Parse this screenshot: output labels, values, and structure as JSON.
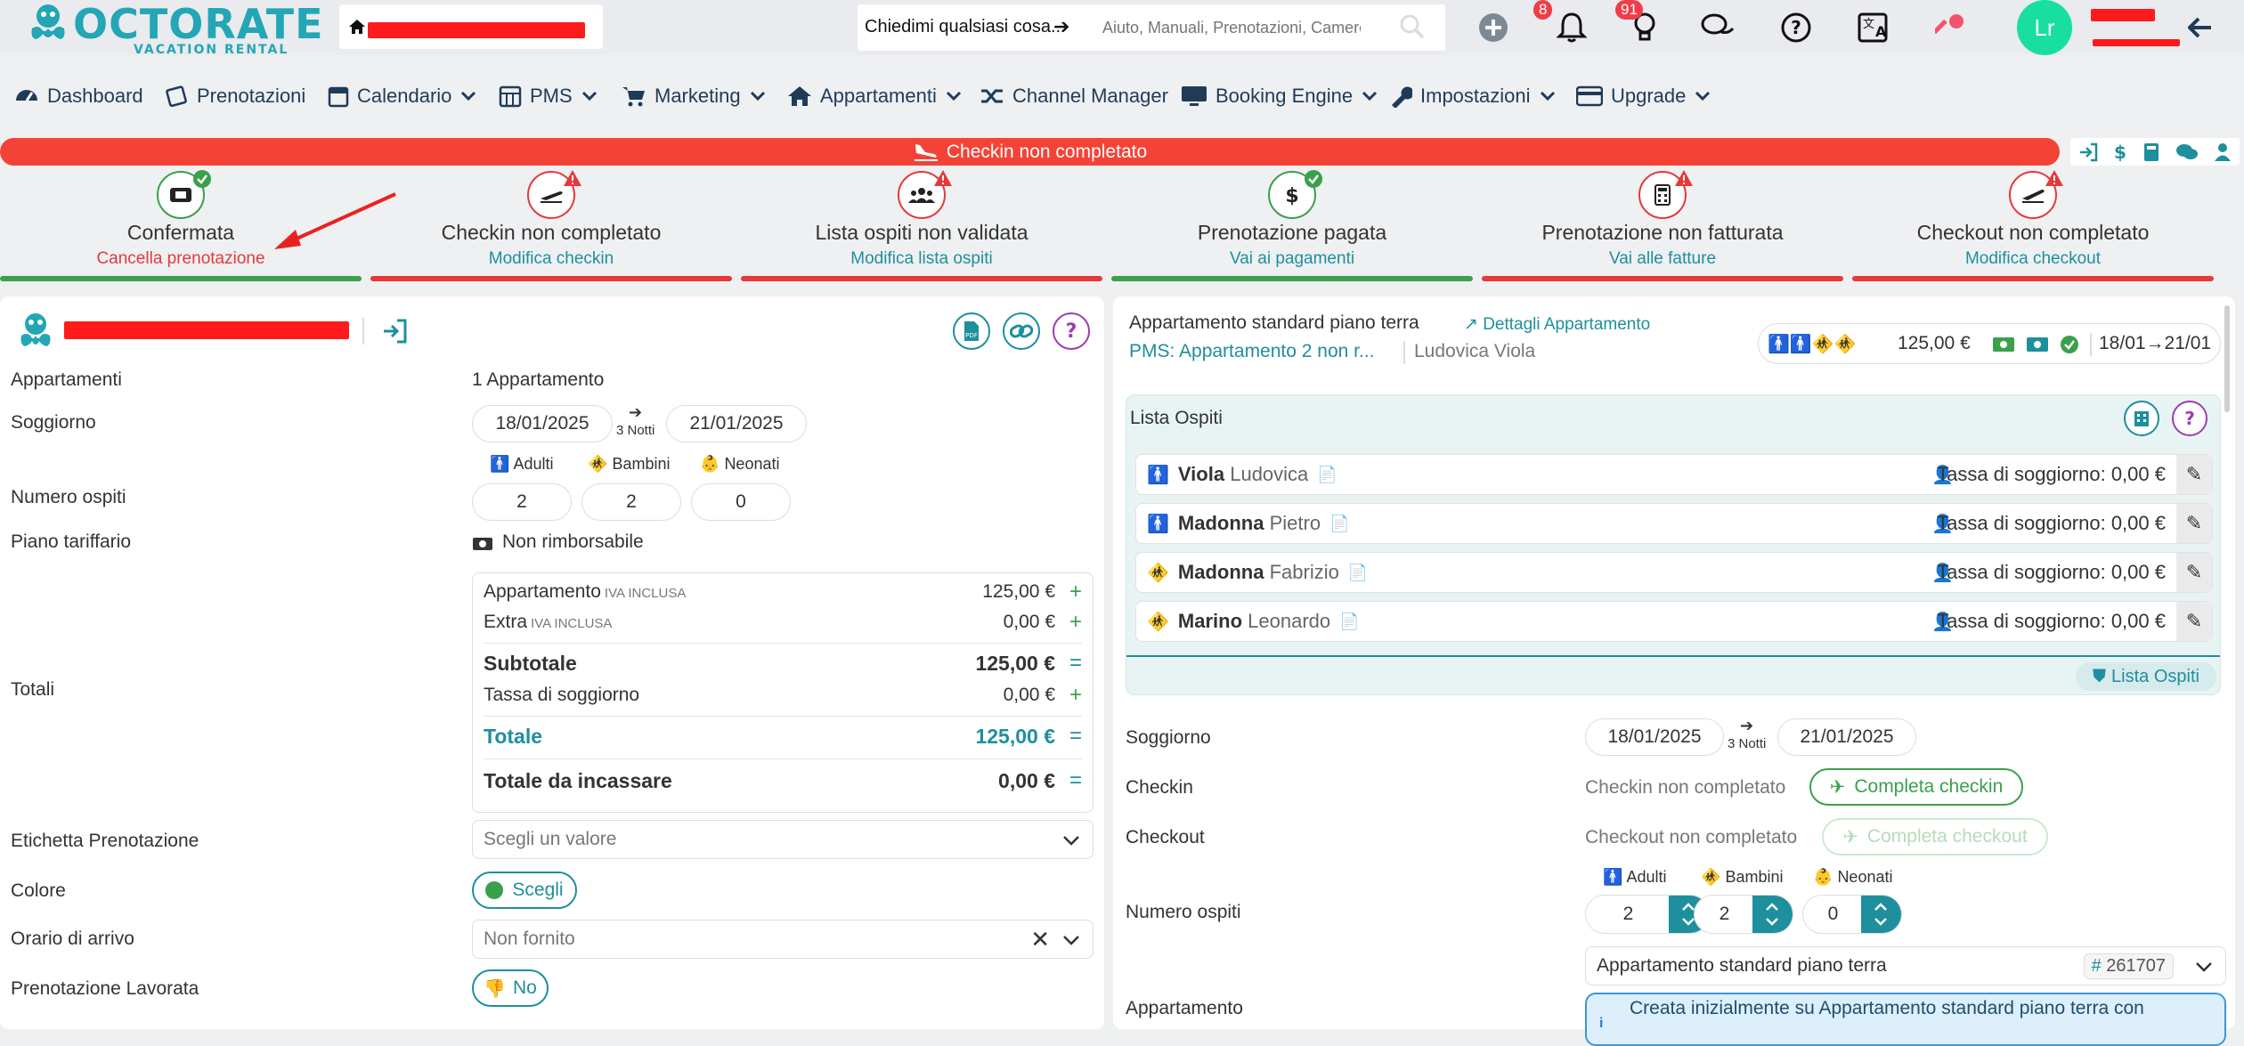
{
  "header": {
    "logo_text": "OCTORATE",
    "logo_sub": "VACATION RENTAL",
    "ask_label": "Chiedimi qualsiasi cosa...",
    "search_placeholder": "Aiuto, Manuali, Prenotazioni, Camere ecc",
    "notifications_count": "8",
    "ideas_count": "91",
    "avatar_initials": "Lr"
  },
  "nav": {
    "items": [
      {
        "label": "Dashboard"
      },
      {
        "label": "Prenotazioni"
      },
      {
        "label": "Calendario"
      },
      {
        "label": "PMS"
      },
      {
        "label": "Marketing"
      },
      {
        "label": "Appartamenti"
      },
      {
        "label": "Channel Manager"
      },
      {
        "label": "Booking Engine"
      },
      {
        "label": "Impostazioni"
      },
      {
        "label": "Upgrade"
      }
    ]
  },
  "alert": {
    "text": "Checkin non completato"
  },
  "steps": [
    {
      "title": "Confermata",
      "link": "Cancella prenotazione",
      "status": "ok"
    },
    {
      "title": "Checkin non completato",
      "link": "Modifica checkin",
      "status": "warn"
    },
    {
      "title": "Lista ospiti non validata",
      "link": "Modifica lista ospiti",
      "status": "warn"
    },
    {
      "title": "Prenotazione pagata",
      "link": "Vai ai pagamenti",
      "status": "ok"
    },
    {
      "title": "Prenotazione non fatturata",
      "link": "Vai alle fatture",
      "status": "warn"
    },
    {
      "title": "Checkout non completato",
      "link": "Modifica checkout",
      "status": "warn"
    }
  ],
  "left": {
    "labels": {
      "appartamenti": "Appartamenti",
      "soggiorno": "Soggiorno",
      "numero_ospiti": "Numero ospiti",
      "piano_tariffario": "Piano tariffario",
      "totali": "Totali",
      "etichetta": "Etichetta Prenotazione",
      "colore": "Colore",
      "orario": "Orario di arrivo",
      "lavorata": "Prenotazione Lavorata"
    },
    "appartamenti_value": "1 Appartamento",
    "checkin_date": "18/01/2025",
    "checkout_date": "21/01/2025",
    "nights": "3 Notti",
    "guests": {
      "adulti_label": "Adulti",
      "bambini_label": "Bambini",
      "neonati_label": "Neonati",
      "adulti": "2",
      "bambini": "2",
      "neonati": "0"
    },
    "rate_plan": "Non rimborsabile",
    "totals": {
      "appartamento_label": "Appartamento",
      "appartamento_note": "IVA INCLUSA",
      "appartamento_value": "125,00 €",
      "extra_label": "Extra",
      "extra_note": "IVA INCLUSA",
      "extra_value": "0,00 €",
      "subtotale_label": "Subtotale",
      "subtotale_value": "125,00 €",
      "tassa_label": "Tassa di soggiorno",
      "tassa_value": "0,00 €",
      "totale_label": "Totale",
      "totale_value": "125,00 €",
      "incassare_label": "Totale da incassare",
      "incassare_value": "0,00 €"
    },
    "etichetta_placeholder": "Scegli un valore",
    "colore_button": "Scegli",
    "orario_value": "Non fornito",
    "lavorata_button": "No"
  },
  "right": {
    "room_title": "Appartamento standard piano terra",
    "details_link": "Dettagli Appartamento",
    "pms_link": "PMS: Appartamento 2 non r...",
    "guest_name": "Ludovica Viola",
    "price": "125,00 €",
    "dates": "18/01→21/01",
    "guest_list_title": "Lista Ospiti",
    "guests": [
      {
        "last": "Viola",
        "first": "Ludovica",
        "tax": "Tassa di soggiorno: 0,00 €"
      },
      {
        "last": "Madonna",
        "first": "Pietro",
        "tax": "Tassa di soggiorno: 0,00 €"
      },
      {
        "last": "Madonna",
        "first": "Fabrizio",
        "tax": "Tassa di soggiorno: 0,00 €"
      },
      {
        "last": "Marino",
        "first": "Leonardo",
        "tax": "Tassa di soggiorno: 0,00 €"
      }
    ],
    "guest_list_button": "Lista Ospiti",
    "labels": {
      "soggiorno": "Soggiorno",
      "checkin": "Checkin",
      "checkout": "Checkout",
      "numero_ospiti": "Numero ospiti",
      "appartamento": "Appartamento"
    },
    "checkin_date": "18/01/2025",
    "checkout_date": "21/01/2025",
    "nights": "3 Notti",
    "checkin_status": "Checkin non completato",
    "checkin_button": "Completa checkin",
    "checkout_status": "Checkout non completato",
    "checkout_button": "Completa checkout",
    "guests_count": {
      "adulti_label": "Adulti",
      "bambini_label": "Bambini",
      "neonati_label": "Neonati",
      "adulti": "2",
      "bambini": "2",
      "neonati": "0"
    },
    "room_select": "Appartamento standard piano terra",
    "room_id": "261707",
    "info_text": "Creata inizialmente su Appartamento standard piano terra con"
  },
  "colors": {
    "teal": "#1e8f9d",
    "red": "#f44336",
    "green": "#3aa04c"
  }
}
